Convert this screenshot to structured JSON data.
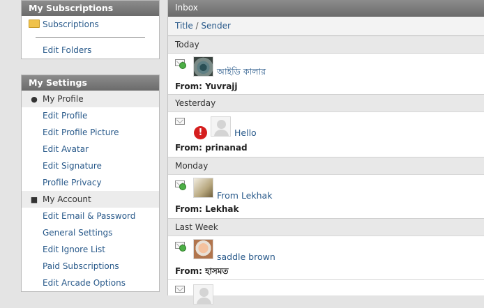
{
  "subscriptions": {
    "title": "My Subscriptions",
    "folder_label": "Subscriptions",
    "edit_folders": "Edit Folders"
  },
  "settings": {
    "title": "My Settings",
    "profile_section": "My Profile",
    "profile_links": [
      "Edit Profile",
      "Edit Profile Picture",
      "Edit Avatar",
      "Edit Signature",
      "Profile Privacy"
    ],
    "account_section": "My Account",
    "account_links": [
      "Edit Email & Password",
      "General Settings",
      "Edit Ignore List",
      "Paid Subscriptions",
      "Edit Arcade Options"
    ]
  },
  "inbox": {
    "header": "Inbox",
    "sort": {
      "title": "Title",
      "sep": "/",
      "sender": "Sender"
    },
    "groups": [
      "Today",
      "Yesterday",
      "Monday",
      "Last Week"
    ],
    "messages": [
      {
        "title": "আইডি কালার",
        "from_label": "From:",
        "sender": "Yuvrajj",
        "icon": "envelope-new-icon",
        "avatar": "eye-photo"
      },
      {
        "title": "Hello",
        "from_label": "From:",
        "sender": "prinanad",
        "icon": "envelope-icon",
        "avatar": "default-avatar",
        "flag": "!"
      },
      {
        "title": "From Lekhak",
        "from_label": "From:",
        "sender": "Lekhak",
        "icon": "envelope-new-icon",
        "avatar": "lekhak-photo"
      },
      {
        "title": "saddle brown",
        "from_label": "From:",
        "sender": "হাসমত",
        "icon": "envelope-new-icon",
        "avatar": "face-photo"
      }
    ]
  }
}
